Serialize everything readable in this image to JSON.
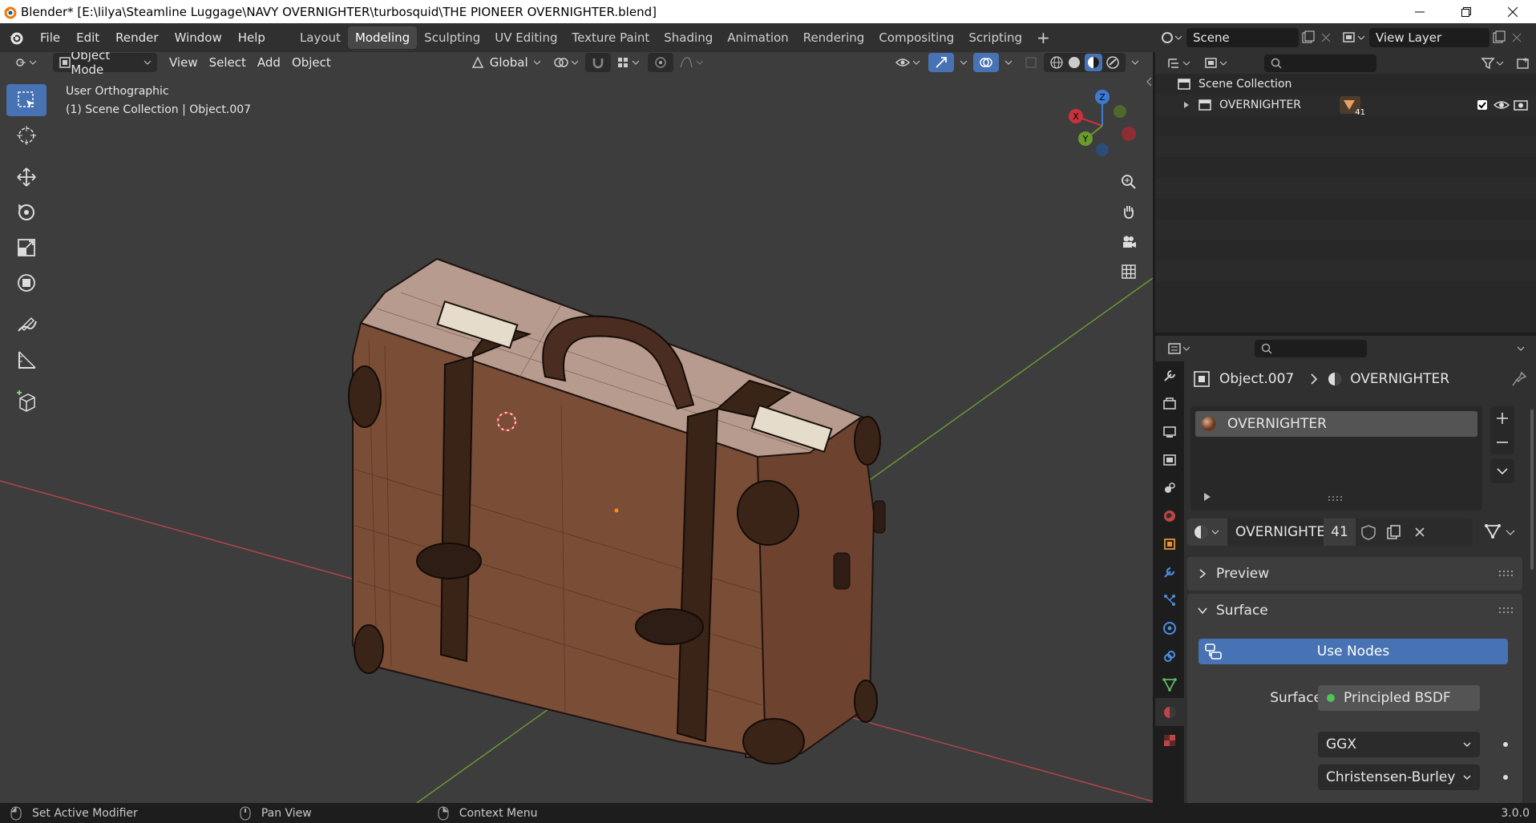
{
  "window": {
    "title": "Blender* [E:\\lilya\\Steamline Luggage\\NAVY OVERNIGHTER\\turbosquid\\THE PIONEER OVERNIGHTER.blend]"
  },
  "menubar": {
    "items": [
      "File",
      "Edit",
      "Render",
      "Window",
      "Help"
    ]
  },
  "workspaces": {
    "tabs": [
      "Layout",
      "Modeling",
      "Sculpting",
      "UV Editing",
      "Texture Paint",
      "Shading",
      "Animation",
      "Rendering",
      "Compositing",
      "Scripting"
    ],
    "active": "Modeling",
    "add_label": "+"
  },
  "scene": {
    "name": "Scene"
  },
  "view_layer": {
    "name": "View Layer"
  },
  "viewport": {
    "mode": "Object Mode",
    "menus": [
      "View",
      "Select",
      "Add",
      "Object"
    ],
    "orientation": "Global",
    "view_name": "User Orthographic",
    "context": "(1) Scene Collection | Object.007",
    "gizmo": {
      "x": "X",
      "y": "Y",
      "z": "Z"
    }
  },
  "outliner": {
    "root": "Scene Collection",
    "items": [
      {
        "name": "OVERNIGHTER",
        "badge": "41"
      }
    ]
  },
  "properties": {
    "breadcrumb_object": "Object.007",
    "breadcrumb_material": "OVERNIGHTER",
    "slot_name": "OVERNIGHTER",
    "material_name": "OVERNIGHTER",
    "user_count": "41",
    "panels": {
      "preview": "Preview",
      "surface": "Surface"
    },
    "use_nodes_label": "Use Nodes",
    "surface_label": "Surface",
    "surface_shader": "Principled BSDF",
    "distribution": "GGX",
    "subsurface_method": "Christensen-Burley"
  },
  "statusbar": {
    "left": "Set Active Modifier",
    "middle": "Pan View",
    "right": "Context Menu",
    "version": "3.0.0"
  },
  "colors": {
    "accent": "#4772b3",
    "x_axis": "#c8323c",
    "y_axis": "#6a9a2a",
    "z_axis": "#3b7bd6",
    "suitcase": "#8a5a40"
  }
}
